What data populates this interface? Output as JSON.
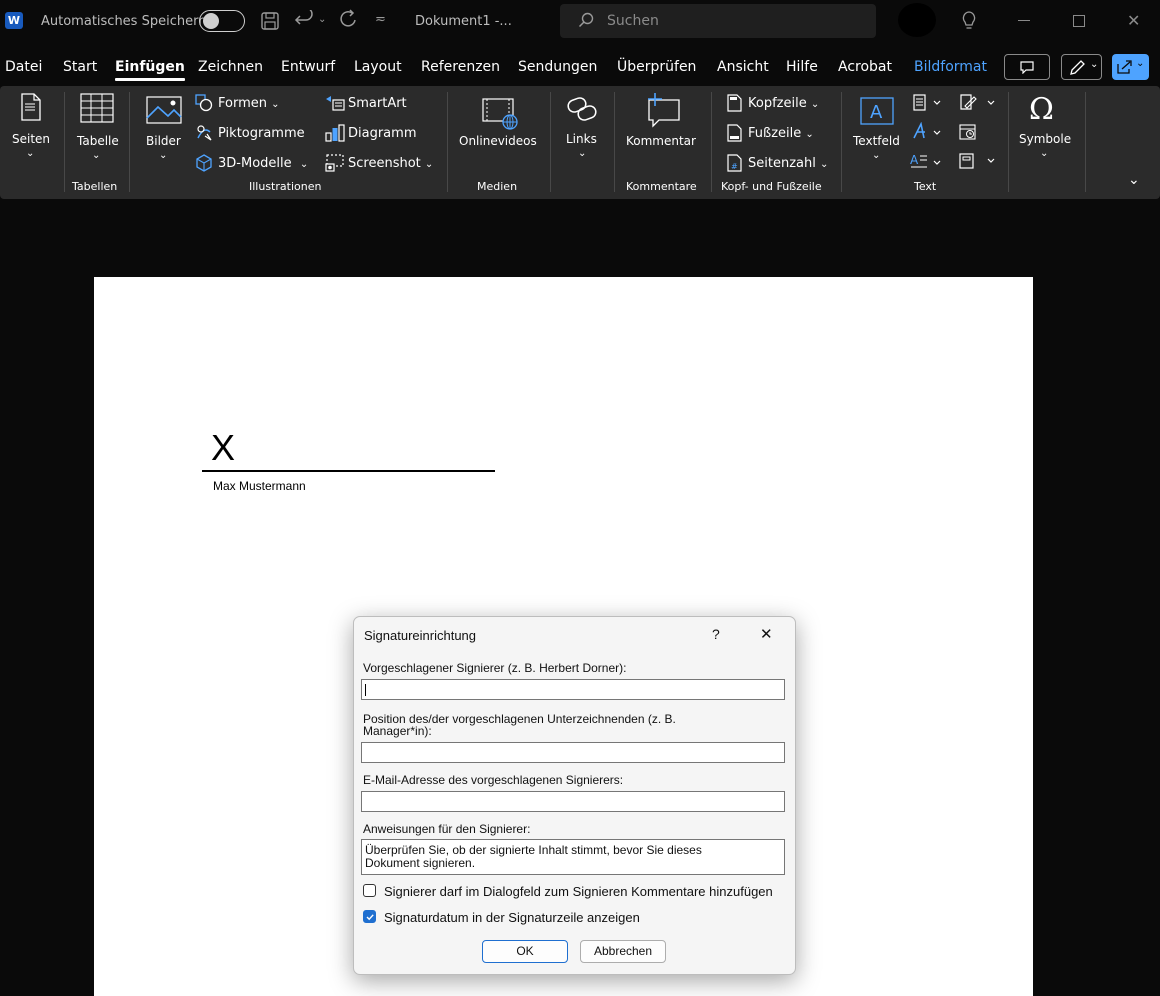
{
  "titlebar": {
    "app_icon_letter": "W",
    "autosave_label": "Automatisches Speichern",
    "document_title": "Dokument1 -...",
    "search_placeholder": "Suchen"
  },
  "menu": {
    "items": [
      "Datei",
      "Start",
      "Einfügen",
      "Zeichnen",
      "Entwurf",
      "Layout",
      "Referenzen",
      "Sendungen",
      "Überprüfen",
      "Ansicht",
      "Hilfe",
      "Acrobat",
      "Bildformat"
    ],
    "active": "Einfügen",
    "accent": "#4ea3ff"
  },
  "ribbon": {
    "seiten": "Seiten",
    "tabelle": "Tabelle",
    "bilder": "Bilder",
    "formen": "Formen",
    "piktogramme": "Piktogramme",
    "modelle": "3D-Modelle",
    "smartart": "SmartArt",
    "diagramm": "Diagramm",
    "screenshot": "Screenshot",
    "onlinevideos": "Onlinevideos",
    "links": "Links",
    "kommentar": "Kommentar",
    "kopfzeile": "Kopfzeile",
    "fusszeile": "Fußzeile",
    "seitenzahl": "Seitenzahl",
    "textfeld": "Textfeld",
    "symbole": "Symbole",
    "groups": {
      "tabellen": "Tabellen",
      "illustrationen": "Illustrationen",
      "medien": "Medien",
      "kommentare": "Kommentare",
      "kopf_fuss": "Kopf- und Fußzeile",
      "text": "Text"
    }
  },
  "document": {
    "signature_x": "X",
    "signer_name": "Max Mustermann"
  },
  "dialog": {
    "title": "Signatureinrichtung",
    "help": "?",
    "close": "✕",
    "signer_label": "Vorgeschlagener Signierer (z. B. Herbert Dorner):",
    "position_label_1": "Position des/der vorgeschlagenen Unterzeichnenden (z. B.",
    "position_label_2": "Manager*in):",
    "email_label": "E-Mail-Adresse des vorgeschlagenen Signierers:",
    "instructions_label": "Anweisungen für den Signierer:",
    "instructions_line1": "Überprüfen Sie, ob der signierte Inhalt stimmt, bevor Sie dieses",
    "instructions_line2": "Dokument signieren.",
    "checkbox_comments": "Signierer darf im Dialogfeld zum Signieren Kommentare hinzufügen",
    "checkbox_date": "Signaturdatum in der Signaturzeile anzeigen",
    "ok": "OK",
    "cancel": "Abbrechen"
  }
}
